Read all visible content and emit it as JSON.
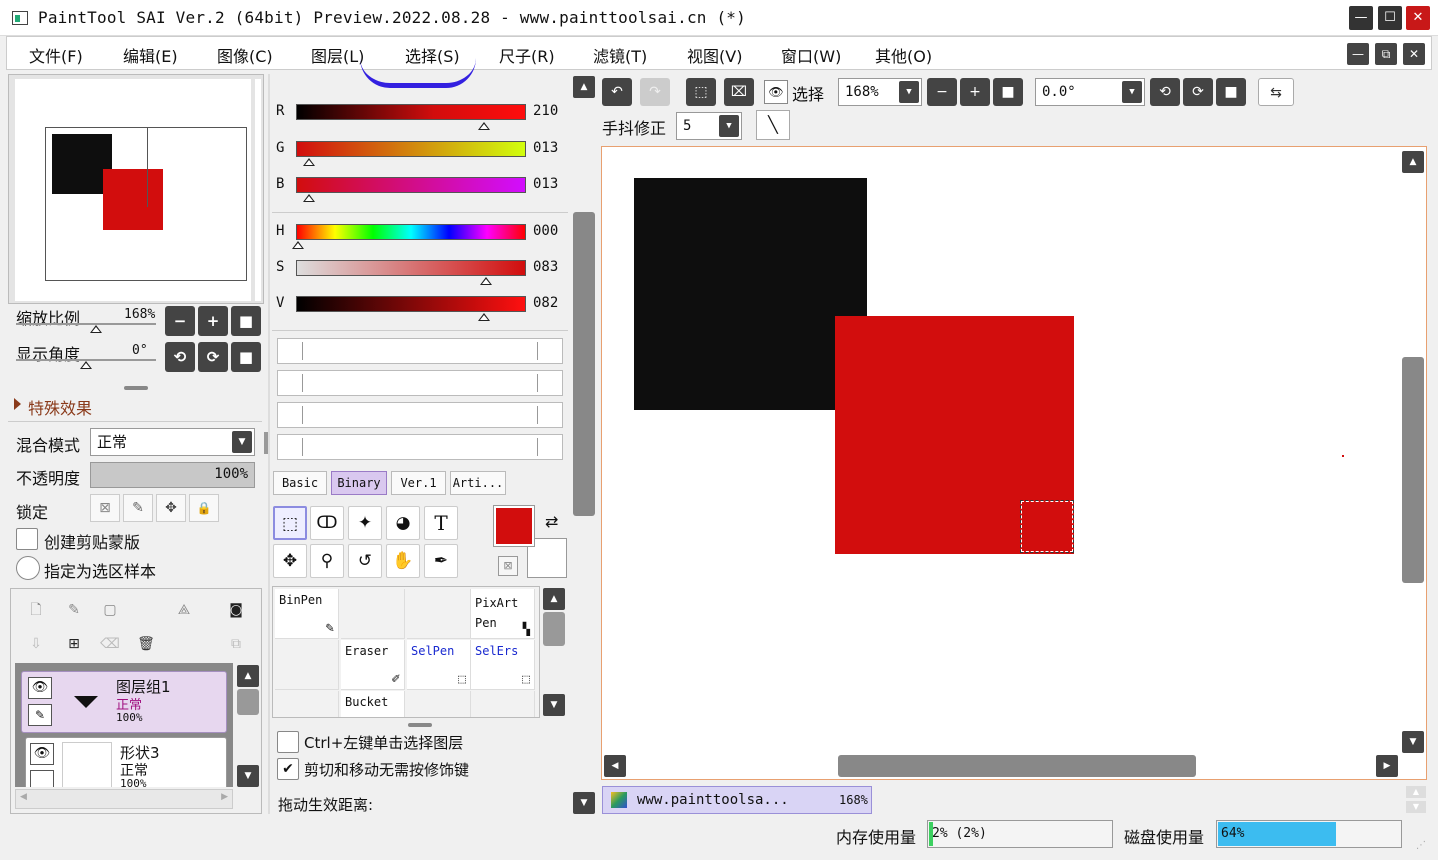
{
  "window": {
    "title": "PaintTool SAI Ver.2 (64bit) Preview.2022.08.28 - www.painttoolsai.cn (*)",
    "minimize": "—",
    "maximize": "☐",
    "close": "✕"
  },
  "menu": {
    "items": [
      "文件(F)",
      "编辑(E)",
      "图像(C)",
      "图层(L)",
      "选择(S)",
      "尺子(R)",
      "滤镜(T)",
      "视图(V)",
      "窗口(W)",
      "其他(O)"
    ]
  },
  "navigator": {
    "zoom_label": "缩放比例",
    "zoom_value": "168%",
    "angle_label": "显示角度",
    "angle_value": "0°"
  },
  "layer_props": {
    "effects_label": "特殊效果",
    "blend_label": "混合模式",
    "blend_value": "正常",
    "opacity_label": "不透明度",
    "opacity_value": "100%",
    "opacity_fraction": 1.0,
    "lock_label": "锁定",
    "clip_label": "创建剪贴蒙版",
    "sample_label": "指定为选区样本"
  },
  "layers": [
    {
      "name": "图层组1",
      "mode": "正常",
      "opacity": "100%",
      "selected": true
    },
    {
      "name": "形状3",
      "mode": "正常",
      "opacity": "100%",
      "selected": false
    }
  ],
  "color": {
    "r": {
      "label": "R",
      "value": "210"
    },
    "g": {
      "label": "G",
      "value": "013"
    },
    "b": {
      "label": "B",
      "value": "013"
    },
    "h": {
      "label": "H",
      "value": "000"
    },
    "s": {
      "label": "S",
      "value": "083"
    },
    "v": {
      "label": "V",
      "value": "082"
    },
    "primary": "#d20d0d",
    "secondary": "#ffffff"
  },
  "brush_tabs": [
    "Basic",
    "Binary",
    "Ver.1",
    "Arti..."
  ],
  "brush_tabs_active": "Binary",
  "brushes": {
    "binpen": "BinPen",
    "pixart": "PixArt Pen",
    "eraser": "Eraser",
    "selpen": "SelPen",
    "selers": "SelErs",
    "bucket": "Bucket"
  },
  "options": {
    "ctrl_click": "Ctrl+左键单击选择图层",
    "cut_move": "剪切和移动无需按修饰键",
    "drag_distance": "拖动生效距离:"
  },
  "toolbar": {
    "select_label": "选择",
    "zoom": "168%",
    "rotation": "0.0°",
    "stabilizer_label": "手抖修正",
    "stabilizer_value": "5"
  },
  "canvas": {
    "black_color": "#0e0e0e",
    "red_color": "#d20d0d"
  },
  "document_tab": {
    "name": "www.painttoolsa...",
    "zoom": "168%"
  },
  "status": {
    "memory_label": "内存使用量",
    "memory_value": "2% (2%)",
    "memory_fraction": 0.02,
    "disk_label": "磁盘使用量",
    "disk_value": "64%",
    "disk_fraction": 0.64
  }
}
